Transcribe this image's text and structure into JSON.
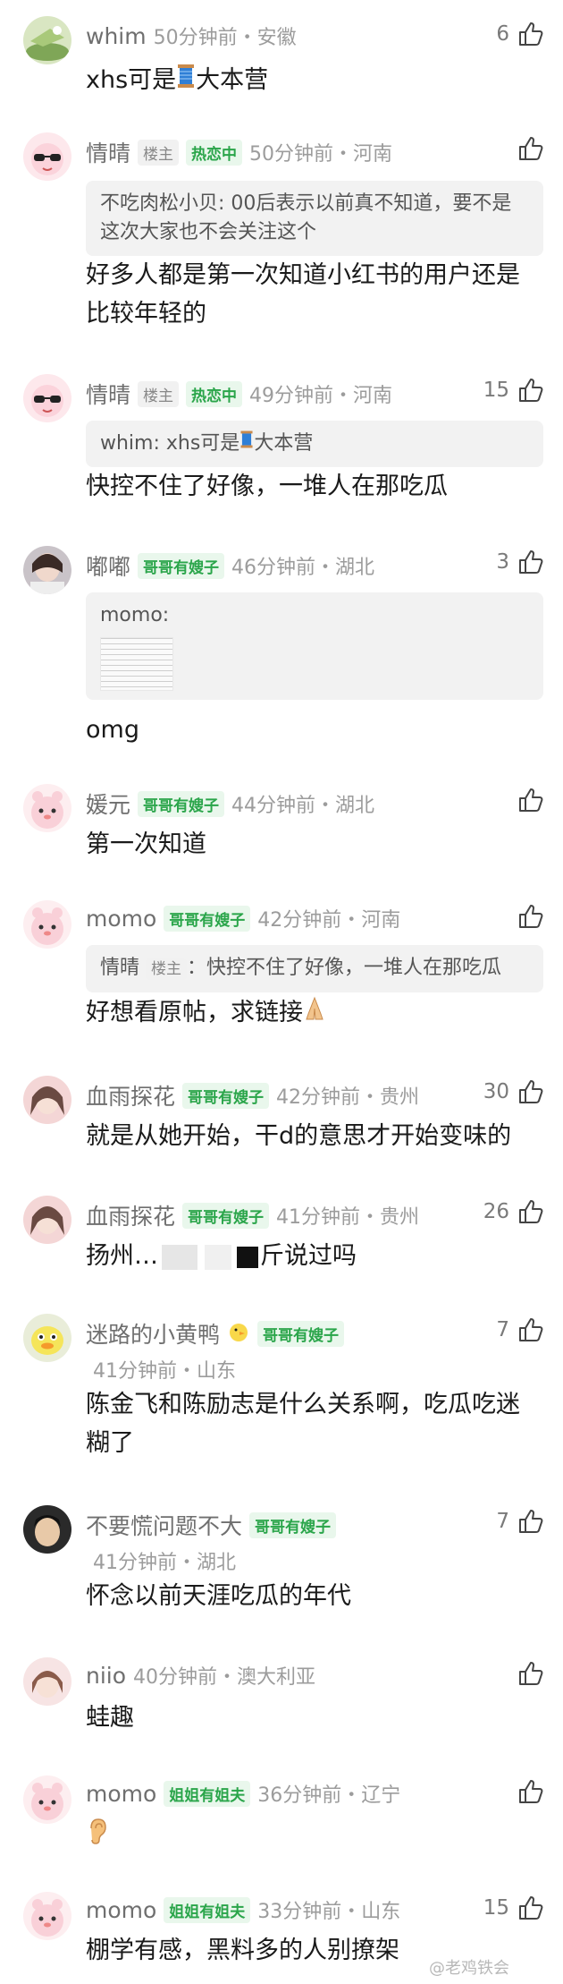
{
  "comments": [
    {
      "name": "whim",
      "meta": "50分钟前・安徽",
      "likes": "6",
      "body_pre": "xhs可是",
      "body_emoji": "spool-of-thread-icon",
      "body_post": "大本营"
    },
    {
      "name": "情晴",
      "owner_badge": "楼主",
      "tag": "热恋中",
      "meta": "50分钟前・河南",
      "likes": "",
      "quote": "不吃肉松小贝: 00后表示以前真不知道，要不是这次大家也不会关注这个",
      "body": "好多人都是第一次知道小红书的用户还是比较年轻的"
    },
    {
      "name": "情晴",
      "owner_badge": "楼主",
      "tag": "热恋中",
      "meta": "49分钟前・河南",
      "likes": "15",
      "quote_pre": "whim: xhs可是",
      "quote_post": "大本营",
      "body": "快控不住了好像，一堆人在那吃瓜"
    },
    {
      "name": "嘟嘟",
      "tag": "哥哥有嫂子",
      "meta": "46分钟前・湖北",
      "likes": "3",
      "quote": "momo:",
      "body": "omg"
    },
    {
      "name": "媛元",
      "tag": "哥哥有嫂子",
      "meta": "44分钟前・湖北",
      "likes": "",
      "body": "第一次知道"
    },
    {
      "name": "momo",
      "tag": "哥哥有嫂子",
      "meta": "42分钟前・河南",
      "likes": "",
      "quote_name": "情晴",
      "quote_owner": "楼主",
      "quote_text": "：快控不住了好像，一堆人在那吃瓜",
      "body": "好想看原帖，求链接"
    },
    {
      "name": "血雨探花",
      "tag": "哥哥有嫂子",
      "meta": "42分钟前・贵州",
      "likes": "30",
      "body": "就是从她开始，干d的意思才开始变味的"
    },
    {
      "name": "血雨探花",
      "tag": "哥哥有嫂子",
      "meta": "41分钟前・贵州",
      "likes": "26",
      "body_pre": "扬州…",
      "body_post": "斤说过吗"
    },
    {
      "name": "迷路的小黄鸭",
      "tag": "哥哥有嫂子",
      "meta": "41分钟前・山东",
      "likes": "7",
      "body": "陈金飞和陈励志是什么关系啊，吃瓜吃迷糊了"
    },
    {
      "name": "不要慌问题不大",
      "tag": "哥哥有嫂子",
      "meta": "41分钟前・湖北",
      "likes": "7",
      "body": "怀念以前天涯吃瓜的年代"
    },
    {
      "name": "niio",
      "meta": "40分钟前・澳大利亚",
      "likes": "",
      "body": "蛙趣"
    },
    {
      "name": "momo",
      "tag": "姐姐有姐夫",
      "meta": "36分钟前・辽宁",
      "likes": "",
      "body_emoji": "ear-icon"
    },
    {
      "name": "momo",
      "tag": "姐姐有姐夫",
      "meta": "33分钟前・山东",
      "likes": "15",
      "body": "棚学有感，黑料多的人别撩架"
    }
  ],
  "watermark": "@老鸡铁会",
  "colors": {
    "accent_green": "#2aa54a",
    "text_gray": "#9c9c9c"
  }
}
